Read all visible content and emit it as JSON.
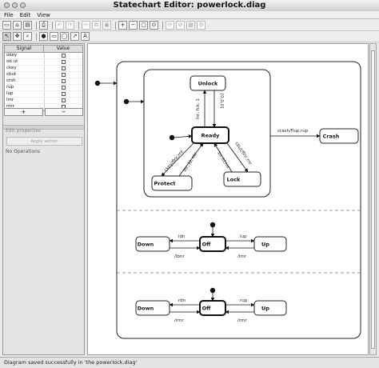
{
  "window": {
    "title": "Statechart Editor: powerlock.diag"
  },
  "menu": {
    "items": [
      "File",
      "Edit",
      "View"
    ]
  },
  "toolbar1": {
    "new": "▭",
    "open": "⌂",
    "save": "▤",
    "print": "⎙",
    "undo": "↶",
    "redo": "↷",
    "cut": "✂",
    "copy": "⧉",
    "paste": "▣",
    "zoom_in": "+",
    "zoom_out": "−",
    "zoom_fit": "▢",
    "zoom_reset": "⊙",
    "run": "⟳",
    "step": "⊘",
    "stop": "▩",
    "settings": "⚙"
  },
  "toolbar2": {
    "select": "↖",
    "pan": "✥",
    "lasso": "⌕",
    "initial": "●",
    "state": "▭",
    "composite": "◯",
    "transition": "↗",
    "text": "A"
  },
  "signals": {
    "header_signal": "Signal",
    "header_value": "Value",
    "rows": [
      "okey",
      "ob ut",
      "ckey",
      "cbut",
      "crsh",
      "rup",
      "lup",
      "lmr",
      "rmr"
    ]
  },
  "buttons": {
    "add": "+",
    "remove": "−"
  },
  "properties": {
    "title": "Edit properties",
    "apply": "Apply action",
    "no_operations": "No Operations"
  },
  "diagram": {
    "states": {
      "unlock": "Unlock",
      "ready": "Ready",
      "protect": "Protect",
      "lock": "Lock",
      "crash": "Crash",
      "down1": "Down",
      "off1": "Off",
      "up1": "Up",
      "down2": "Down",
      "off2": "Off",
      "up2": "Up"
    },
    "transitions": {
      "ready_unlock": "lnr, fck, 1",
      "unlock_ready": "[0,0,0]",
      "ready_protect": "ckey/flnr,rnr",
      "protect_ready": "lnr, ld, rnr",
      "ready_lock": "cbut/flnr,rnr",
      "lock_ready": "lnr,ld,rnr",
      "crash": "crash/flup,rup",
      "off1_down": "ldn",
      "down_off1": "/lbnr",
      "off1_up": "lup",
      "up_off1": "/lmr",
      "off2_down": "rdn",
      "down_off2": "/rmr",
      "off2_up": "rup",
      "up_off2": "/rmr"
    }
  },
  "status": {
    "message": "Diagram saved successfully in 'the powerlock.diag'"
  }
}
